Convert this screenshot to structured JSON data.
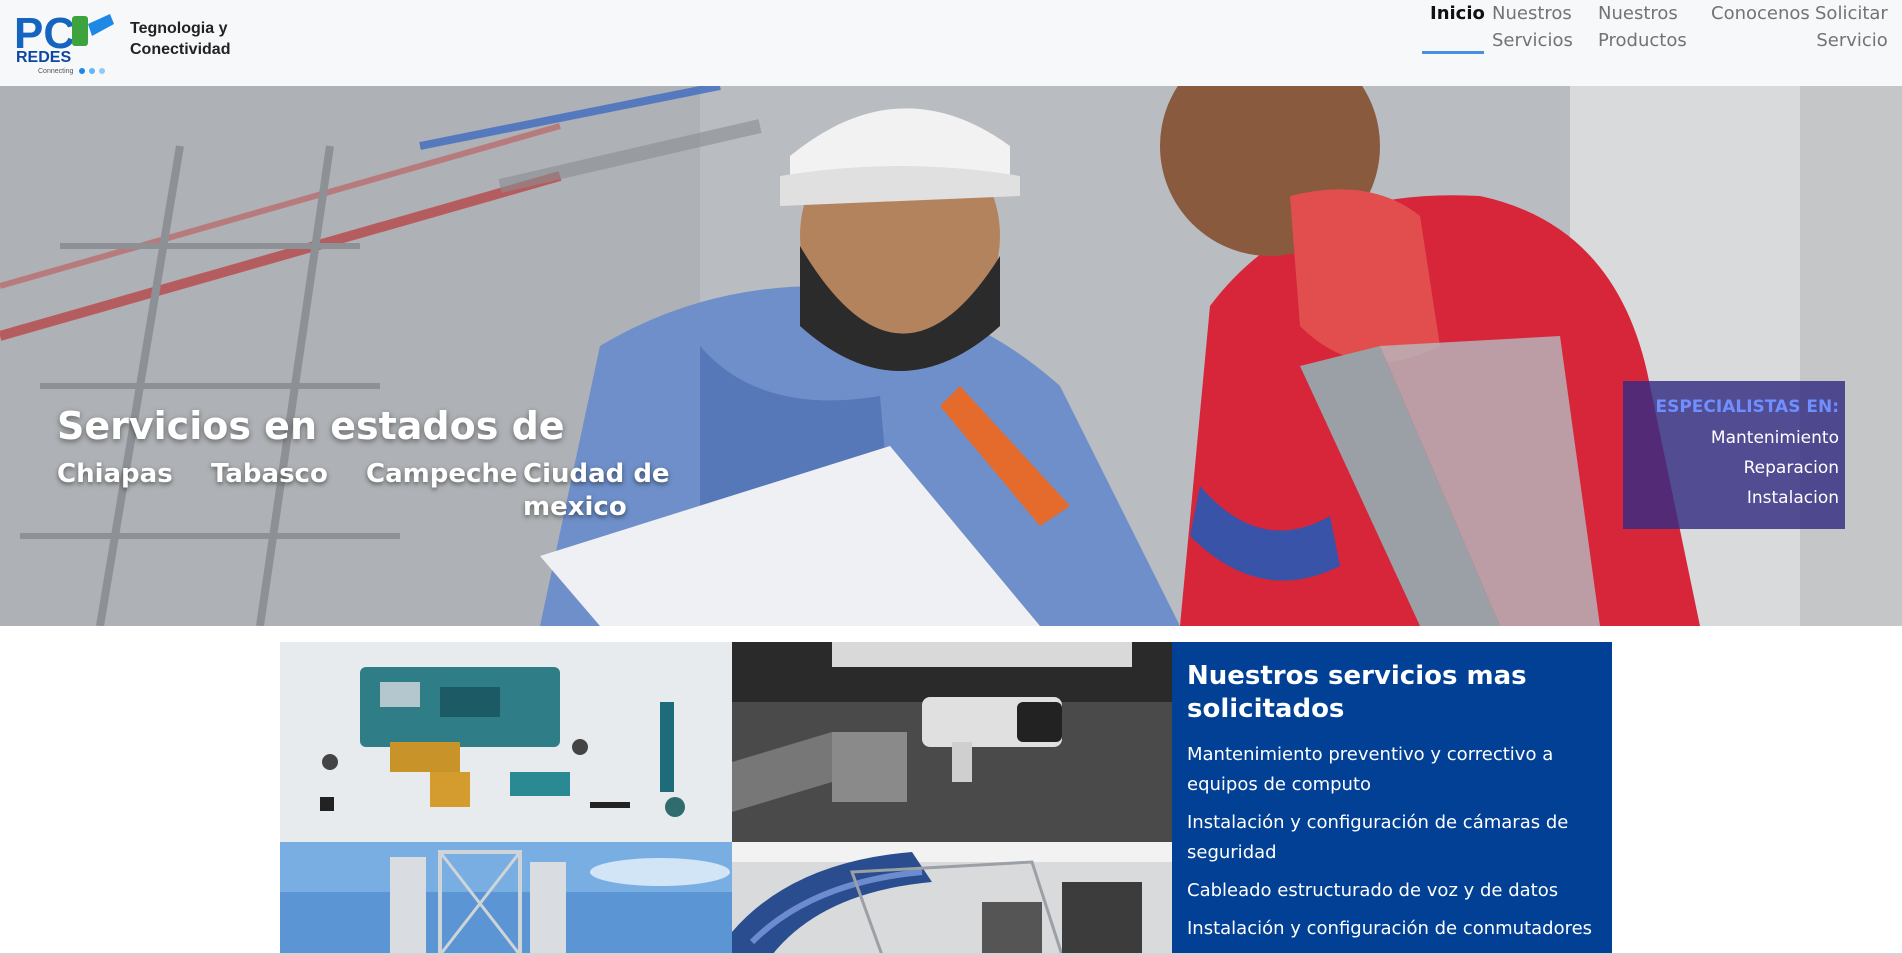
{
  "brand": {
    "logo_text": "PC",
    "logo_sub": "REDES",
    "logo_tagline": "Connecting",
    "tagline_line1": "Tegnologia y",
    "tagline_line2": "Conectividad"
  },
  "nav": {
    "items": [
      {
        "line1": "Inicio",
        "line2": ""
      },
      {
        "line1": "Nuestros",
        "line2": "Servicios"
      },
      {
        "line1": "Nuestros",
        "line2": "Productos"
      },
      {
        "line1": "Conocenos",
        "line2": ""
      },
      {
        "line1": "Solicitar",
        "line2": "Servicio"
      }
    ],
    "active": "Inicio"
  },
  "hero": {
    "title": "Servicios en estados de",
    "states": [
      {
        "line1": "Chiapas",
        "line2": ""
      },
      {
        "line1": "Tabasco",
        "line2": ""
      },
      {
        "line1": "Campeche",
        "line2": ""
      },
      {
        "line1": "Ciudad de",
        "line2": "mexico"
      }
    ],
    "specialists": {
      "title": "ESPECIALISTAS EN:",
      "items": [
        "Mantenimiento",
        "Reparacion",
        "Instalacion"
      ]
    }
  },
  "services": {
    "title": "Nuestros servicios mas solicitados",
    "items": [
      "Mantenimiento preventivo y correctivo a equipos de computo",
      "Instalación y configuración de cámaras de seguridad",
      "Cableado estructurado de voz y de datos",
      "Instalación y configuración de conmutadores"
    ]
  },
  "colors": {
    "accent": "#4a90e2",
    "panel": "#014095",
    "specialist_box": "#352c82",
    "specialist_title": "#6f8fff"
  }
}
